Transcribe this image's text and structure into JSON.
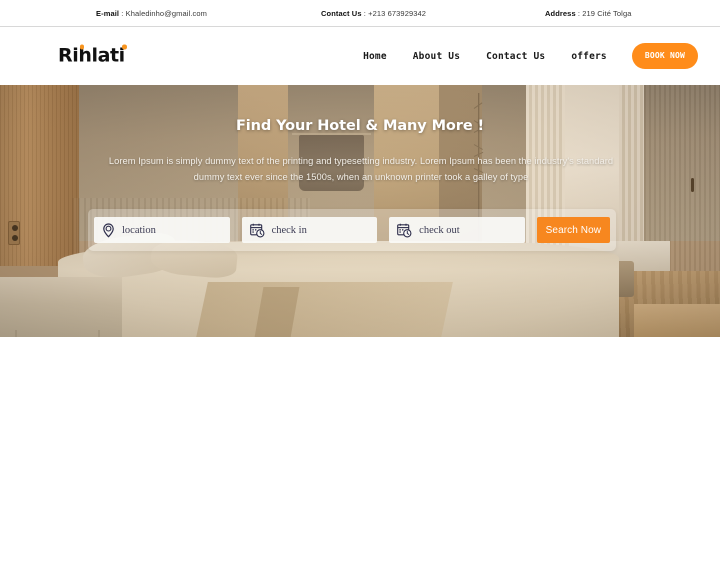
{
  "topbar": {
    "email_label": "E-mail",
    "email_value": " : Khaledinho@gmail.com",
    "contact_label": "Contact Us",
    "contact_value": " : +213 673929342",
    "address_label": "Address",
    "address_value": " : 219 Cité Tolga"
  },
  "brand": {
    "name": "Rihlati",
    "dot_color": "#f7941e"
  },
  "nav": {
    "items": [
      {
        "label": "Home"
      },
      {
        "label": "About Us"
      },
      {
        "label": "Contact Us"
      },
      {
        "label": "offers"
      }
    ],
    "cta": {
      "label": "BOOK NOW",
      "color": "#ff8c1a"
    }
  },
  "hero": {
    "title": "Find Your Hotel & Many More !",
    "subtitle": "Lorem Ipsum is simply dummy text of the printing and typesetting industry. Lorem Ipsum has been the industry's standard dummy text ever since the 1500s, when an unknown printer took a galley of type",
    "search": {
      "location_placeholder": "location",
      "location_value": "",
      "checkin_placeholder": "check in",
      "checkin_value": "",
      "checkout_placeholder": "check out",
      "checkout_value": "",
      "button_label": "Search Now",
      "button_color": "#f7871f"
    }
  }
}
